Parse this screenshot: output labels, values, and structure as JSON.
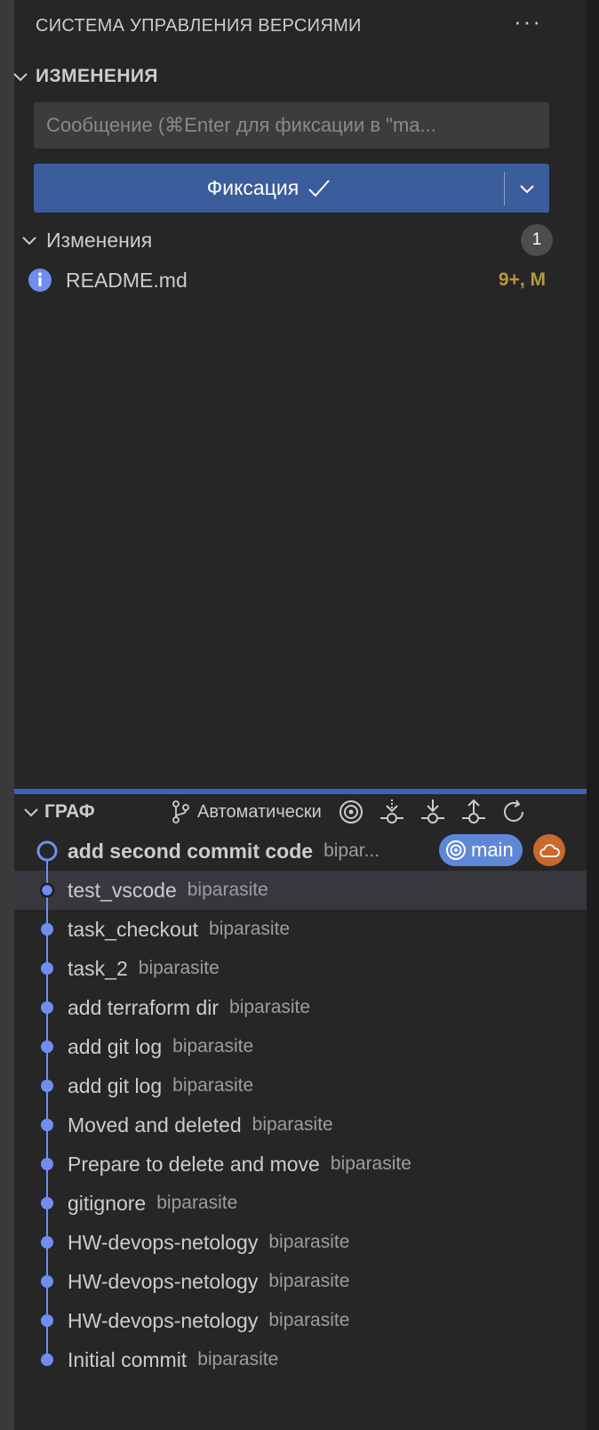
{
  "header": {
    "title": "СИСТЕМА УПРАВЛЕНИЯ ВЕРСИЯМИ",
    "more": "···"
  },
  "changes_section": {
    "title": "ИЗМЕНЕНИЯ",
    "message_placeholder": "Сообщение (⌘Enter для фиксации в \"ma...",
    "commit_label": "Фиксация",
    "group_label": "Изменения",
    "group_count": "1",
    "files": [
      {
        "name": "README.md",
        "status": "9+, M",
        "icon": "info-icon"
      }
    ]
  },
  "graph": {
    "title": "ГРАФ",
    "auto_label": "Автоматически",
    "branch": "main",
    "commits": [
      {
        "message": "add second commit code",
        "author": "bipar..."
      },
      {
        "message": "test_vscode",
        "author": "biparasite"
      },
      {
        "message": "task_checkout",
        "author": "biparasite"
      },
      {
        "message": "task_2",
        "author": "biparasite"
      },
      {
        "message": "add terraform dir",
        "author": "biparasite"
      },
      {
        "message": "add git log",
        "author": "biparasite"
      },
      {
        "message": "add git log",
        "author": "biparasite"
      },
      {
        "message": "Moved and deleted",
        "author": "biparasite"
      },
      {
        "message": "Prepare to delete and move",
        "author": "biparasite"
      },
      {
        "message": "gitignore",
        "author": "biparasite"
      },
      {
        "message": "HW-devops-netology",
        "author": "biparasite"
      },
      {
        "message": "HW-devops-netology",
        "author": "biparasite"
      },
      {
        "message": "HW-devops-netology",
        "author": "biparasite"
      },
      {
        "message": "Initial commit",
        "author": "biparasite"
      }
    ]
  },
  "colors": {
    "accent": "#3c5d9c",
    "graph_line": "#6e8ff0",
    "status_modified": "#b89a3e",
    "branch_pill": "#5f87d8",
    "remote_pill": "#c76a2b"
  }
}
